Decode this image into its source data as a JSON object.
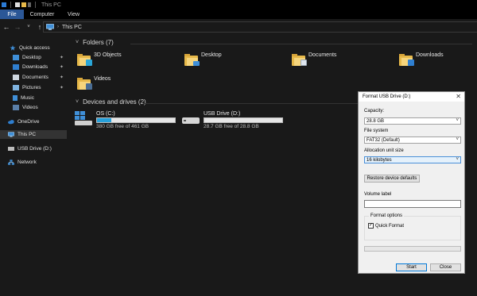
{
  "window": {
    "title": "This PC"
  },
  "ribbon": {
    "tabs": [
      "File",
      "Computer",
      "View"
    ]
  },
  "address": {
    "path": "This PC"
  },
  "sidebar": {
    "items": [
      {
        "label": "Quick access",
        "icon": "star-icon",
        "pinned": false
      },
      {
        "label": "Desktop",
        "icon": "desktop-folder-icon",
        "pinned": true
      },
      {
        "label": "Downloads",
        "icon": "downloads-folder-icon",
        "pinned": true
      },
      {
        "label": "Documents",
        "icon": "documents-folder-icon",
        "pinned": true
      },
      {
        "label": "Pictures",
        "icon": "pictures-folder-icon",
        "pinned": true
      },
      {
        "label": "Music",
        "icon": "music-folder-icon",
        "pinned": false
      },
      {
        "label": "Videos",
        "icon": "videos-folder-icon",
        "pinned": false
      },
      {
        "label": "OneDrive",
        "icon": "cloud-icon",
        "pinned": false
      },
      {
        "label": "This PC",
        "icon": "computer-icon",
        "pinned": false
      },
      {
        "label": "USB Drive (D:)",
        "icon": "usb-drive-icon",
        "pinned": false
      },
      {
        "label": "Network",
        "icon": "network-icon",
        "pinned": false
      }
    ]
  },
  "folders_group": {
    "header": "Folders (7)",
    "items": [
      {
        "label": "3D Objects",
        "icon": "3d-objects-folder-icon"
      },
      {
        "label": "Desktop",
        "icon": "desktop-folder-icon"
      },
      {
        "label": "Documents",
        "icon": "documents-folder-icon"
      },
      {
        "label": "Downloads",
        "icon": "downloads-folder-icon"
      },
      {
        "label": "Videos",
        "icon": "videos-folder-icon"
      }
    ]
  },
  "drives_group": {
    "header": "Devices and drives (2)",
    "drives": [
      {
        "name": "OS (C:)",
        "free": "380 GB free of 461 GB",
        "used_fraction": 0.18,
        "icon": "windows-drive-icon"
      },
      {
        "name": "USB Drive (D:)",
        "free": "28.7 GB free of 28.8 GB",
        "used_fraction": 0.0,
        "icon": "usb-drive-icon"
      }
    ]
  },
  "format_dialog": {
    "title": "Format USB Drive (D:)",
    "capacity_label": "Capacity:",
    "capacity_value": "28.8 GB",
    "filesystem_label": "File system",
    "filesystem_value": "FAT32 (Default)",
    "allocation_label": "Allocation unit size",
    "allocation_value": "16 kilobytes",
    "restore_label": "Restore device defaults",
    "volume_label": "Volume label",
    "volume_value": "",
    "options_label": "Format options",
    "quick_format_label": "Quick Format",
    "quick_format_checked": true,
    "progress": 0,
    "start_label": "Start",
    "close_label": "Close"
  },
  "colors": {
    "accent": "#2b5797",
    "progress_fill": "#26a0da",
    "folder": "#e7b94a"
  }
}
